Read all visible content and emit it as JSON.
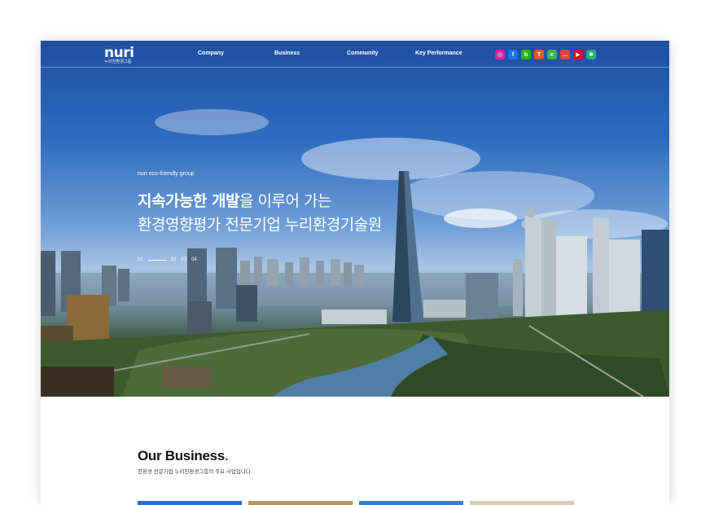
{
  "brand": {
    "logo_text": "nuri",
    "logo_sub": "누리친환경그룹"
  },
  "nav": {
    "items": [
      "Company",
      "Business",
      "Community",
      "Key Performance"
    ]
  },
  "social_icons": [
    {
      "name": "instagram-icon",
      "color": "#d6249f",
      "glyph": "◎"
    },
    {
      "name": "facebook-icon",
      "color": "#1877f2",
      "glyph": "f"
    },
    {
      "name": "naver-blog-icon",
      "color": "#2db400",
      "glyph": "b"
    },
    {
      "name": "tistory-icon",
      "color": "#eb531f",
      "glyph": "T"
    },
    {
      "name": "kakao-channel-icon",
      "color": "#3ab54a",
      "glyph": "c"
    },
    {
      "name": "chat-icon",
      "color": "#e94235",
      "glyph": "…"
    },
    {
      "name": "youtube-icon",
      "color": "#ff0000",
      "glyph": "▶"
    },
    {
      "name": "sitemap-icon",
      "color": "#22b573",
      "glyph": "✱"
    }
  ],
  "hero": {
    "eyebrow": "nuri eco-friendly group",
    "line1_bold": "지속가능한 개발",
    "line1_rest": "을 이루어 가는",
    "line2": "환경영향평가 전문기업 누리환경기술원",
    "pager": {
      "current": "01",
      "others": [
        "02",
        "03",
        "04"
      ]
    }
  },
  "business": {
    "title": "Our Business",
    "title_dot": ".",
    "subtitle": "친환경 전문기업 누리친환경그룹의 주요 사업입니다."
  },
  "cards": [
    "#2c6fc4",
    "#b89062",
    "#3b78c8",
    "#d9cbb5"
  ]
}
